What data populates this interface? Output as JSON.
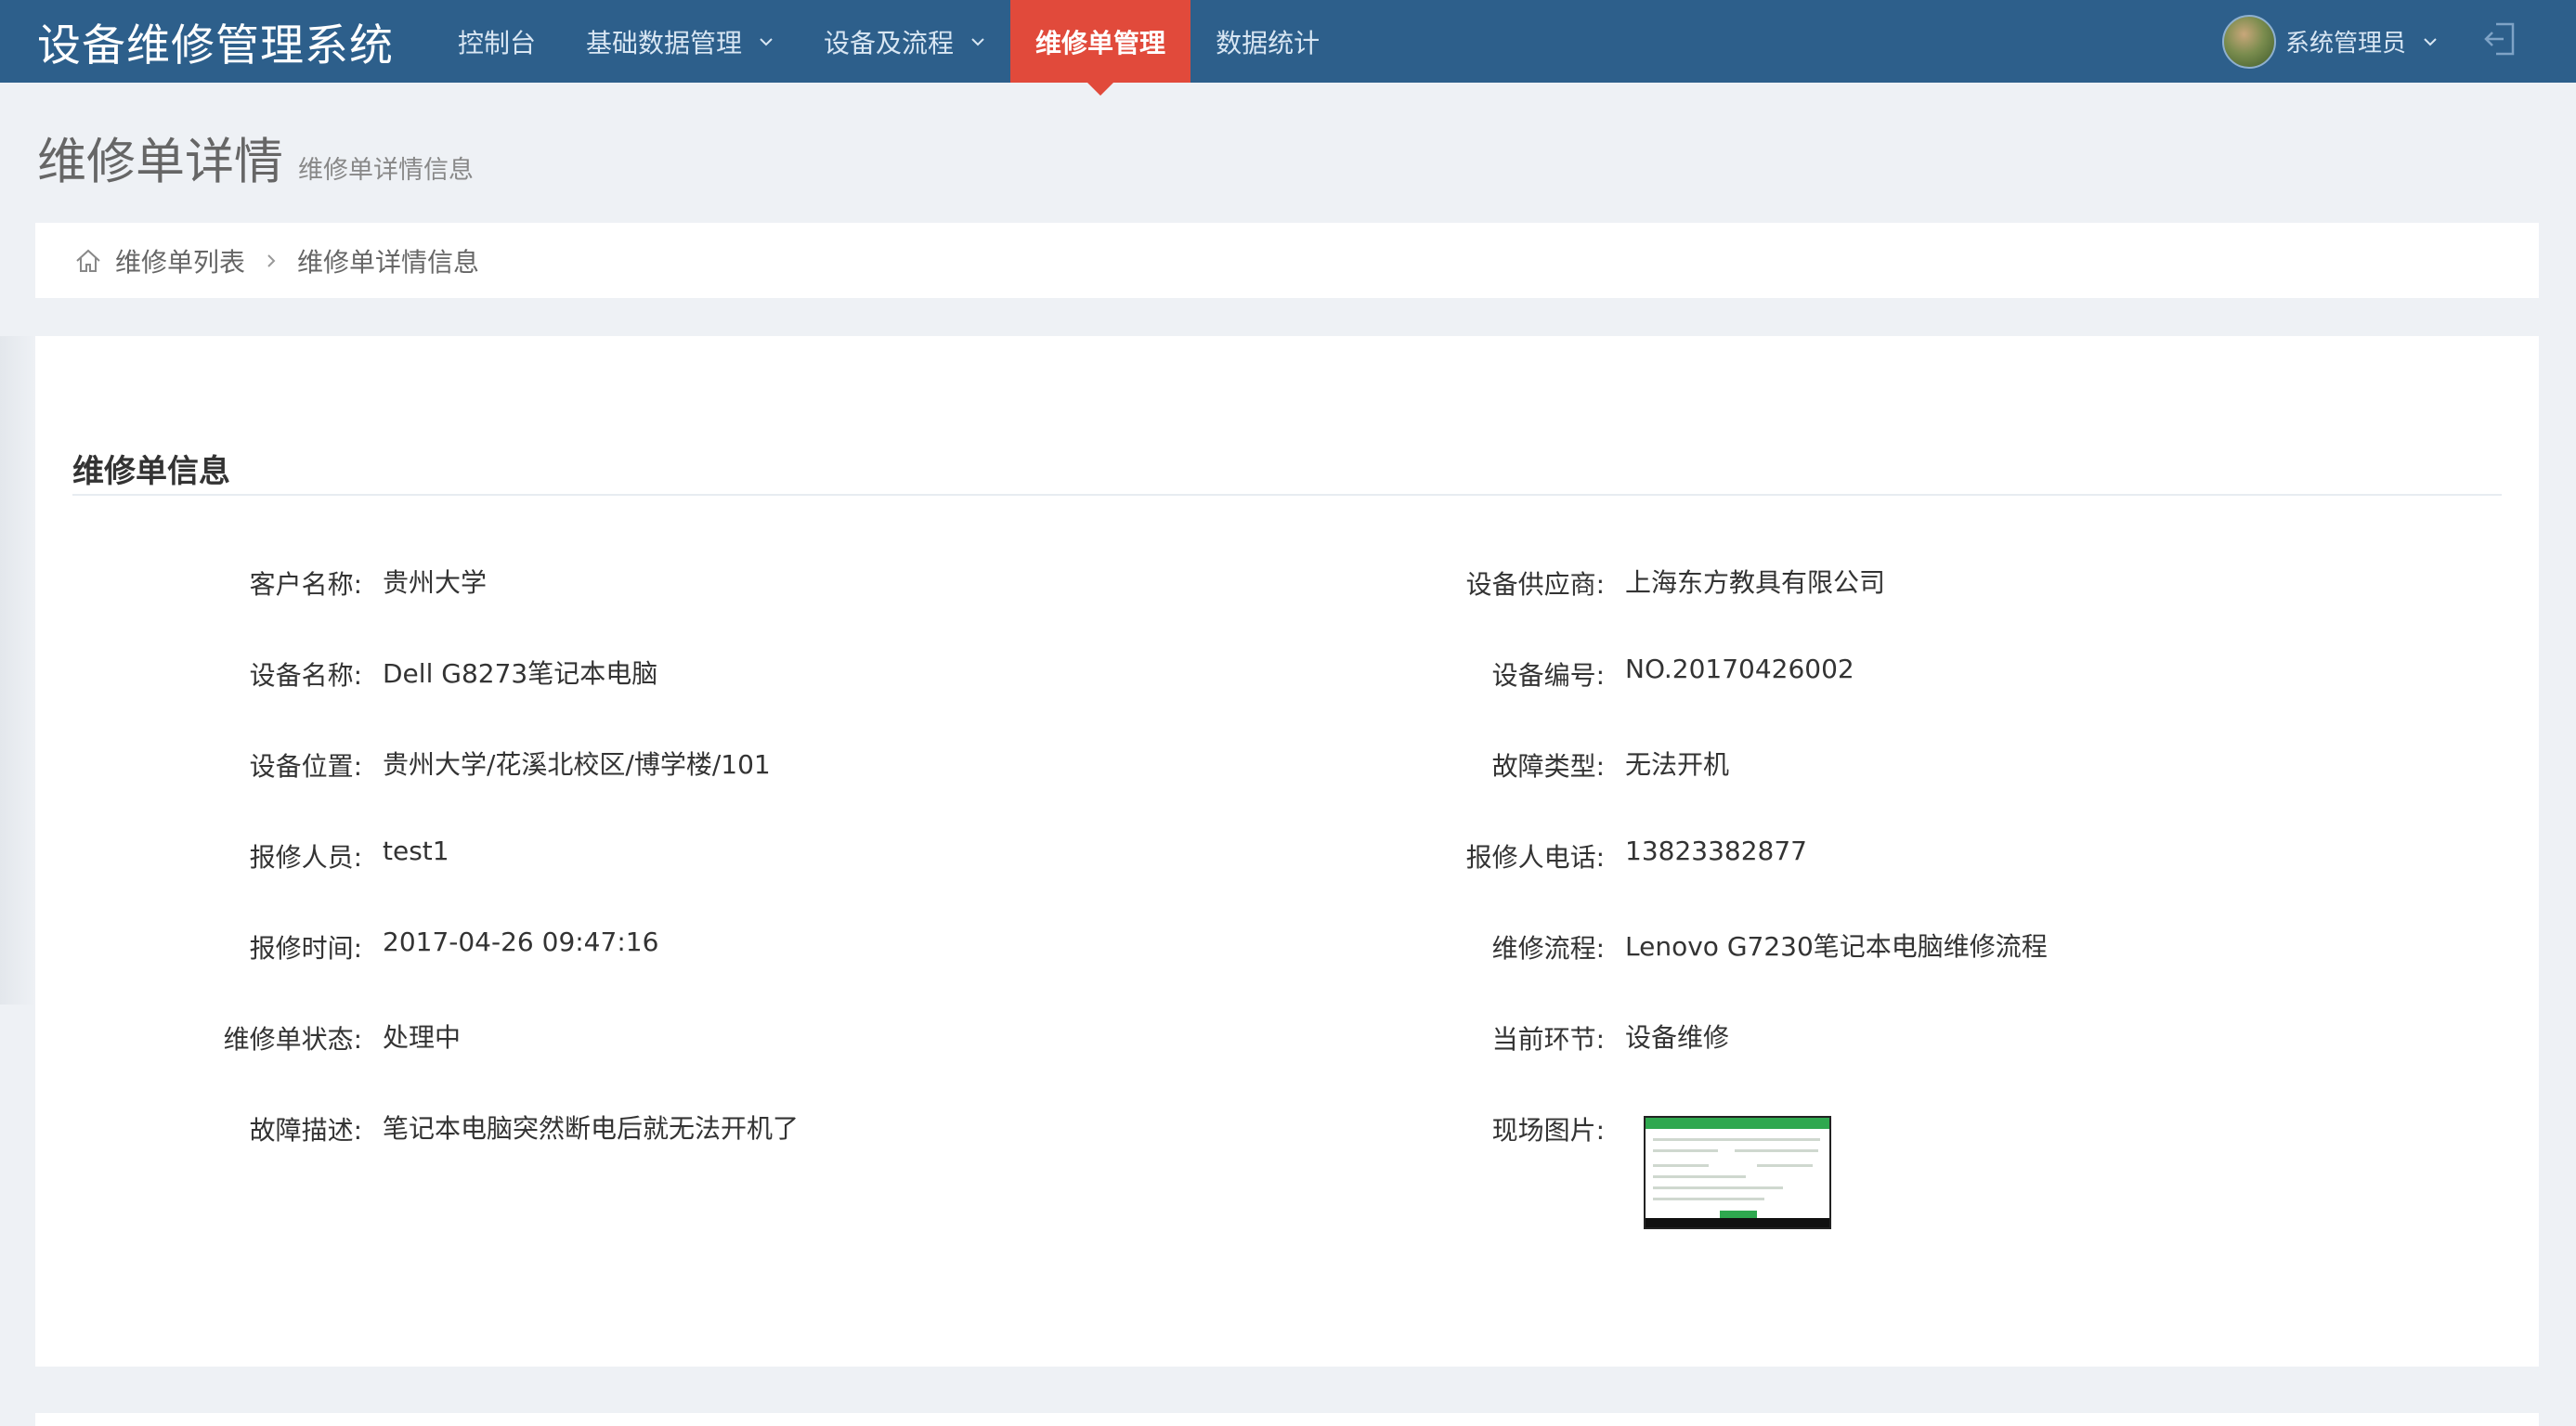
{
  "app": {
    "title": "设备维修管理系统"
  },
  "nav": {
    "items": [
      {
        "label": "控制台",
        "dropdown": false,
        "active": false
      },
      {
        "label": "基础数据管理",
        "dropdown": true,
        "active": false
      },
      {
        "label": "设备及流程",
        "dropdown": true,
        "active": false
      },
      {
        "label": "维修单管理",
        "dropdown": false,
        "active": true
      },
      {
        "label": "数据统计",
        "dropdown": false,
        "active": false
      }
    ],
    "active_color": "#e14a3b",
    "bar_color": "#2d5f8b"
  },
  "user": {
    "name": "系统管理员",
    "avatar_icon": "user-avatar",
    "logout_icon": "logout-icon"
  },
  "page": {
    "title": "维修单详情",
    "subtitle": "维修单详情信息"
  },
  "breadcrumb": {
    "home_icon": "home-icon",
    "items": [
      "维修单列表",
      "维修单详情信息"
    ]
  },
  "panel": {
    "title": "维修单信息"
  },
  "fields": {
    "customer_name": {
      "label": "客户名称:",
      "value": "贵州大学"
    },
    "supplier": {
      "label": "设备供应商:",
      "value": "上海东方教具有限公司"
    },
    "device_name": {
      "label": "设备名称:",
      "value": "Dell G8273笔记本电脑"
    },
    "device_no": {
      "label": "设备编号:",
      "value": "NO.20170426002"
    },
    "device_location": {
      "label": "设备位置:",
      "value": "贵州大学/花溪北校区/博学楼/101"
    },
    "fault_type": {
      "label": "故障类型:",
      "value": "无法开机"
    },
    "reporter": {
      "label": "报修人员:",
      "value": "test1"
    },
    "reporter_phone": {
      "label": "报修人电话:",
      "value": "13823382877"
    },
    "report_time": {
      "label": "报修时间:",
      "value": "2017-04-26 09:47:16"
    },
    "repair_flow": {
      "label": "维修流程:",
      "value": "Lenovo G7230笔记本电脑维修流程"
    },
    "order_status": {
      "label": "维修单状态:",
      "value": "处理中"
    },
    "current_step": {
      "label": "当前环节:",
      "value": "设备维修"
    },
    "fault_desc": {
      "label": "故障描述:",
      "value": "笔记本电脑突然断电后就无法开机了"
    },
    "scene_photo": {
      "label": "现场图片:"
    }
  }
}
